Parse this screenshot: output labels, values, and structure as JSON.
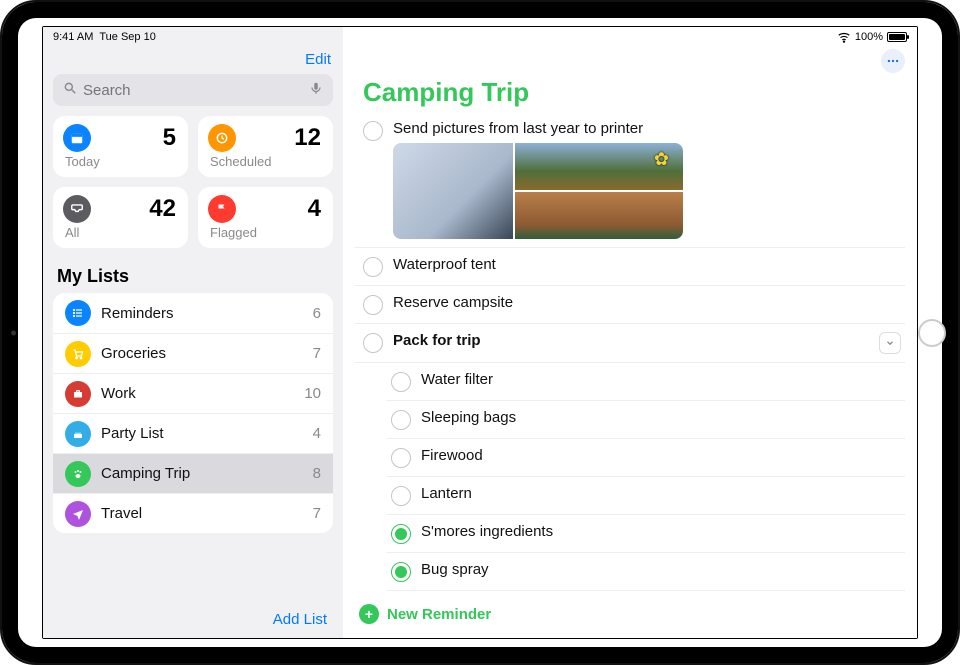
{
  "status": {
    "time": "9:41 AM",
    "date": "Tue Sep 10",
    "battery_pct": "100%"
  },
  "sidebar": {
    "edit": "Edit",
    "search_placeholder": "Search",
    "tiles": {
      "today": {
        "label": "Today",
        "count": "5",
        "icon": "calendar"
      },
      "scheduled": {
        "label": "Scheduled",
        "count": "12",
        "icon": "clock"
      },
      "all": {
        "label": "All",
        "count": "42",
        "icon": "inbox"
      },
      "flagged": {
        "label": "Flagged",
        "count": "4",
        "icon": "flag"
      }
    },
    "section": "My Lists",
    "lists": [
      {
        "name": "Reminders",
        "count": "6",
        "color": "ic-blue",
        "icon": "list"
      },
      {
        "name": "Groceries",
        "count": "7",
        "color": "ic-yellow",
        "icon": "cart"
      },
      {
        "name": "Work",
        "count": "10",
        "color": "ic-darkred",
        "icon": "briefcase"
      },
      {
        "name": "Party List",
        "count": "4",
        "color": "ic-lightblue",
        "icon": "cake"
      },
      {
        "name": "Camping Trip",
        "count": "8",
        "color": "ic-green",
        "icon": "paw",
        "selected": true
      },
      {
        "name": "Travel",
        "count": "7",
        "color": "ic-purple",
        "icon": "plane"
      }
    ],
    "add_list": "Add List"
  },
  "detail": {
    "title": "Camping Trip",
    "items": [
      {
        "text": "Send pictures from last year to printer",
        "done": false,
        "has_attachments": true
      },
      {
        "text": "Waterproof tent",
        "done": false
      },
      {
        "text": "Reserve campsite",
        "done": false
      },
      {
        "text": "Pack for trip",
        "done": false,
        "expandable": true,
        "bold": true,
        "subitems": [
          {
            "text": "Water filter",
            "done": false
          },
          {
            "text": "Sleeping bags",
            "done": false
          },
          {
            "text": "Firewood",
            "done": false
          },
          {
            "text": "Lantern",
            "done": false
          },
          {
            "text": "S'mores ingredients",
            "done": true
          },
          {
            "text": "Bug spray",
            "done": true
          }
        ]
      }
    ],
    "new_reminder": "New Reminder"
  }
}
